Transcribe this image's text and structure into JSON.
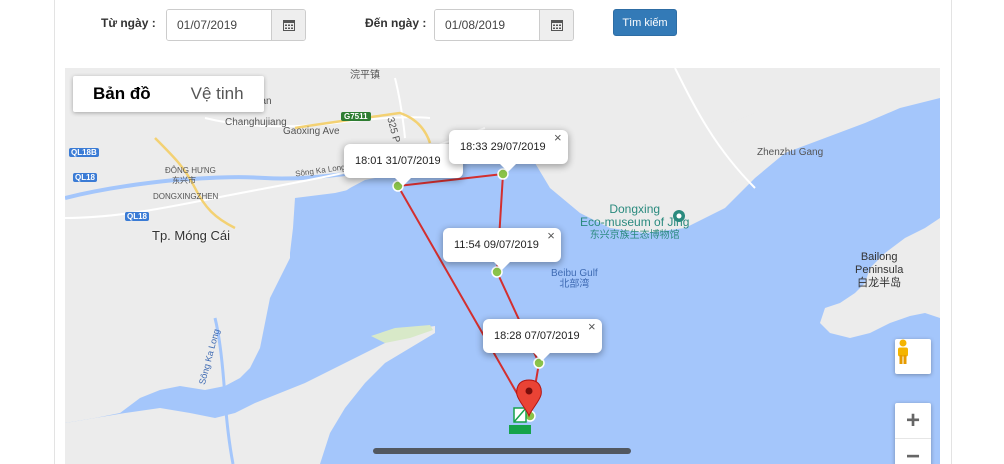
{
  "filter": {
    "from_label": "Từ ngày :",
    "from_value": "01/07/2019",
    "to_label": "Đến ngày :",
    "to_value": "01/08/2019",
    "search_label": "Tìm kiếm"
  },
  "map": {
    "map_types": [
      "Bản đồ",
      "Vệ tinh"
    ],
    "active_map_type": "Bản đồ",
    "track_color": "#d32f2f",
    "waypoints": [
      {
        "time": "18:01 31/07/2019"
      },
      {
        "time": "18:33 29/07/2019"
      },
      {
        "time": "11:54 09/07/2019"
      },
      {
        "time": "18:28 07/07/2019"
      }
    ],
    "zoom_in": "+",
    "zoom_out": "−",
    "labels": {
      "mongcai": "Tp. Móng Cái",
      "dongxing_poi": "Dongxing",
      "dongxing_poi2": "Eco-museum of Jing",
      "dongxing_poi3": "东兴京族生态博物馆",
      "zhenzhu": "Zhenzhu Gang",
      "bailong1": "Bailong",
      "bailong2": "Peninsula",
      "bailong3": "白龙半岛",
      "beibu1": "Beibu Gulf",
      "beibu2": "北部湾",
      "gaoxing": "Gaoxing Ave",
      "changhujiang": "Changhujiang",
      "dongxingzhen": "DONGXINGZHEN",
      "donghung": "ĐÔNG HƯNG",
      "donghung_cn": "东兴市",
      "songkalong": "Sông Ka Long",
      "songkalong2": "Sông Ka Long",
      "engtan": "engtan",
      "ql18b": "QL18B",
      "ql18": "QL18",
      "ql18_2": "QL18",
      "g7511": "G7511",
      "road325": "325 P",
      "top_cn": "浣平镇"
    }
  }
}
